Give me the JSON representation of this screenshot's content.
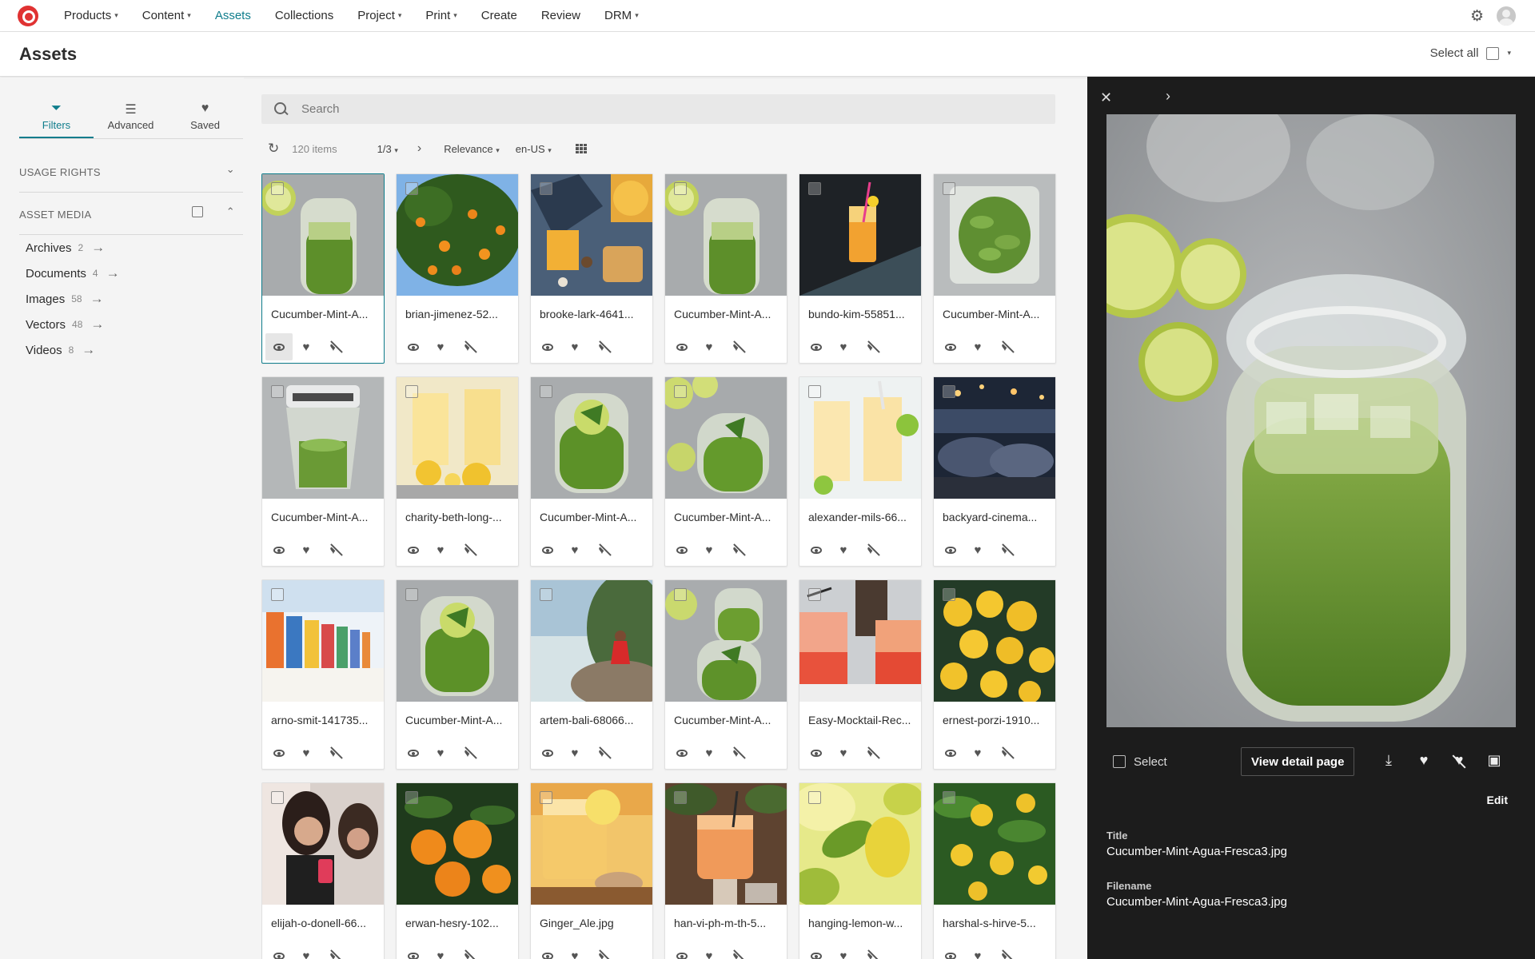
{
  "nav": {
    "items": [
      {
        "label": "Products",
        "caret": true,
        "active": false
      },
      {
        "label": "Content",
        "caret": true,
        "active": false
      },
      {
        "label": "Assets",
        "caret": false,
        "active": true
      },
      {
        "label": "Collections",
        "caret": false,
        "active": false
      },
      {
        "label": "Project",
        "caret": true,
        "active": false
      },
      {
        "label": "Print",
        "caret": true,
        "active": false
      },
      {
        "label": "Create",
        "caret": false,
        "active": false
      },
      {
        "label": "Review",
        "caret": false,
        "active": false
      },
      {
        "label": "DRM",
        "caret": true,
        "active": false
      }
    ],
    "brand_color": "#e03232",
    "accent_color": "#0f7d8c"
  },
  "header": {
    "title": "Assets",
    "select_all_label": "Select all"
  },
  "sidebar": {
    "tabs": [
      {
        "label": "Filters",
        "icon": "funnel-icon",
        "active": true
      },
      {
        "label": "Advanced",
        "icon": "sliders-icon",
        "active": false
      },
      {
        "label": "Saved",
        "icon": "heart-icon",
        "active": false
      }
    ],
    "facets": [
      {
        "label": "USAGE RIGHTS",
        "expanded": false
      },
      {
        "label": "ASSET MEDIA",
        "expanded": true
      }
    ],
    "media_items": [
      {
        "label": "Archives",
        "count": "2"
      },
      {
        "label": "Documents",
        "count": "4"
      },
      {
        "label": "Images",
        "count": "58"
      },
      {
        "label": "Vectors",
        "count": "48"
      },
      {
        "label": "Videos",
        "count": "8"
      }
    ]
  },
  "search": {
    "placeholder": "Search",
    "value": ""
  },
  "toolbar": {
    "count": "120 items",
    "page": "1/3",
    "sort": "Relevance",
    "locale": "en-US"
  },
  "assets": [
    {
      "name": "Cucumber-Mint-A...",
      "img": "jar",
      "selected": true
    },
    {
      "name": "brian-jimenez-52...",
      "img": "orange-tree",
      "selected": false
    },
    {
      "name": "brooke-lark-4641...",
      "img": "brunch",
      "selected": false
    },
    {
      "name": "Cucumber-Mint-A...",
      "img": "jar",
      "selected": false
    },
    {
      "name": "bundo-kim-55851...",
      "img": "cocktail-dark",
      "selected": false
    },
    {
      "name": "Cucumber-Mint-A...",
      "img": "leaves",
      "selected": false
    },
    {
      "name": "Cucumber-Mint-A...",
      "img": "blender",
      "selected": false
    },
    {
      "name": "charity-beth-long-...",
      "img": "lemonade",
      "selected": false
    },
    {
      "name": "Cucumber-Mint-A...",
      "img": "glass",
      "selected": false
    },
    {
      "name": "Cucumber-Mint-A...",
      "img": "glass-limes",
      "selected": false
    },
    {
      "name": "alexander-mils-66...",
      "img": "yellow-drinks",
      "selected": false
    },
    {
      "name": "backyard-cinema...",
      "img": "cinema",
      "selected": false
    },
    {
      "name": "arno-smit-141735...",
      "img": "beach-huts",
      "selected": false
    },
    {
      "name": "Cucumber-Mint-A...",
      "img": "glass",
      "selected": false
    },
    {
      "name": "artem-bali-68066...",
      "img": "beach-woman",
      "selected": false
    },
    {
      "name": "Cucumber-Mint-A...",
      "img": "two-glasses",
      "selected": false
    },
    {
      "name": "Easy-Mocktail-Rec...",
      "img": "mocktail",
      "selected": false
    },
    {
      "name": "ernest-porzi-1910...",
      "img": "lemons",
      "selected": false
    },
    {
      "name": "elijah-o-donell-66...",
      "img": "women",
      "selected": false
    },
    {
      "name": "erwan-hesry-102...",
      "img": "oranges",
      "selected": false
    },
    {
      "name": "Ginger_Ale.jpg",
      "img": "ginger-ale",
      "selected": false
    },
    {
      "name": "han-vi-ph-m-th-5...",
      "img": "orange-drink",
      "selected": false
    },
    {
      "name": "hanging-lemon-w...",
      "img": "hanging-lemon",
      "selected": false
    },
    {
      "name": "harshal-s-hirve-5...",
      "img": "lemon-tree",
      "selected": false
    }
  ],
  "detail": {
    "select_label": "Select",
    "view_detail_label": "View detail page",
    "edit_label": "Edit",
    "title_label": "Title",
    "title_value": "Cucumber-Mint-Agua-Fresca3.jpg",
    "filename_label": "Filename",
    "filename_value": "Cucumber-Mint-Agua-Fresca3.jpg"
  }
}
